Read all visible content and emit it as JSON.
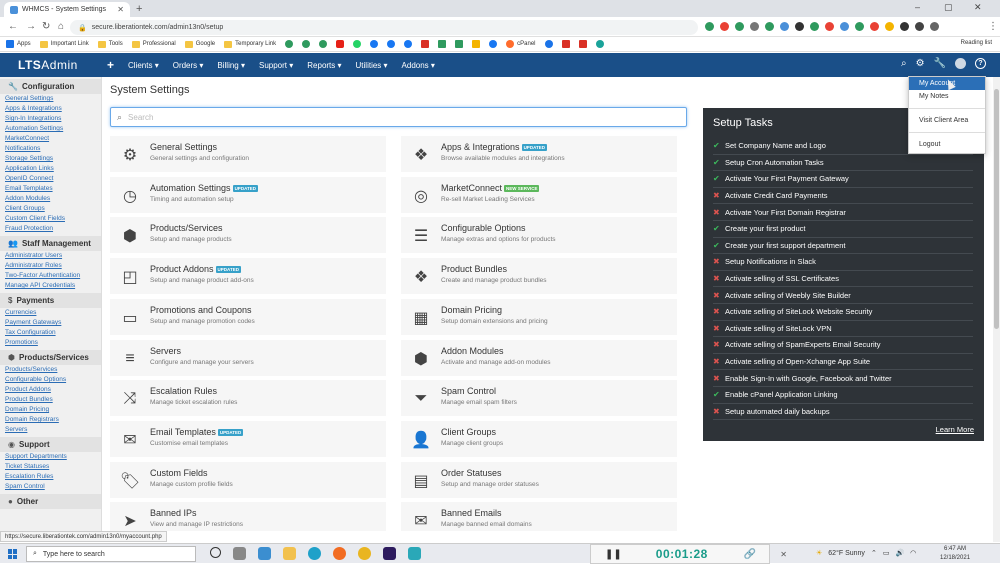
{
  "browser": {
    "tab_title": "WHMCS - System Settings",
    "url": "secure.liberationtek.com/admin13n0/setup",
    "bookmarks": [
      "Apps",
      "Important Link",
      "Tools",
      "Professional",
      "Google",
      "Temporary Link",
      "cPanel"
    ],
    "reading_list": "Reading list"
  },
  "nav": {
    "logo_bold": "LTS",
    "logo_thin": "Admin",
    "plus": "+",
    "menus": [
      "Clients ▾",
      "Orders ▾",
      "Billing ▾",
      "Support ▾",
      "Reports ▾",
      "Utilities ▾",
      "Addons ▾"
    ]
  },
  "dropdown": {
    "items": [
      "My Account",
      "My Notes",
      "Visit Client Area",
      "Logout"
    ]
  },
  "sidebar": {
    "sections": [
      {
        "title": "Configuration",
        "links": [
          "General Settings",
          "Apps & Integrations",
          "Sign-In Integrations",
          "Automation Settings",
          "MarketConnect",
          "Notifications",
          "Storage Settings",
          "Application Links",
          "OpenID Connect",
          "Email Templates",
          "Addon Modules",
          "Client Groups",
          "Custom Client Fields",
          "Fraud Protection"
        ]
      },
      {
        "title": "Staff Management",
        "links": [
          "Administrator Users",
          "Administrator Roles",
          "Two-Factor Authentication",
          "Manage API Credentials"
        ]
      },
      {
        "title": "Payments",
        "links": [
          "Currencies",
          "Payment Gateways",
          "Tax Configuration",
          "Promotions"
        ]
      },
      {
        "title": "Products/Services",
        "links": [
          "Products/Services",
          "Configurable Options",
          "Product Addons",
          "Product Bundles",
          "Domain Pricing",
          "Domain Registrars",
          "Servers"
        ]
      },
      {
        "title": "Support",
        "links": [
          "Support Departments",
          "Ticket Statuses",
          "Escalation Rules",
          "Spam Control"
        ]
      },
      {
        "title": "Other",
        "links": []
      }
    ]
  },
  "main": {
    "title": "System Settings",
    "search_placeholder": "Search",
    "cards": [
      {
        "title": "General Settings",
        "desc": "General settings and configuration",
        "badge": "",
        "icon": "gear-icon",
        "glyph": "⚙"
      },
      {
        "title": "Apps & Integrations",
        "desc": "Browse available modules and integrations",
        "badge": "UPDATED",
        "icon": "puzzle-icon",
        "glyph": "❖"
      },
      {
        "title": "Automation Settings",
        "desc": "Timing and automation setup",
        "badge": "UPDATED",
        "icon": "clock-icon",
        "glyph": "◷"
      },
      {
        "title": "MarketConnect",
        "desc": "Re-sell Market Leading Services",
        "badge": "NEW SERVICE",
        "icon": "target-icon",
        "glyph": "◎"
      },
      {
        "title": "Products/Services",
        "desc": "Setup and manage products",
        "badge": "",
        "icon": "cube-icon",
        "glyph": "⬢"
      },
      {
        "title": "Configurable Options",
        "desc": "Manage extras and options for products",
        "badge": "",
        "icon": "sliders-icon",
        "glyph": "☰"
      },
      {
        "title": "Product Addons",
        "desc": "Setup and manage product add-ons",
        "badge": "UPDATED",
        "icon": "addon-icon",
        "glyph": "◰"
      },
      {
        "title": "Product Bundles",
        "desc": "Create and manage product bundles",
        "badge": "",
        "icon": "cubes-icon",
        "glyph": "❖"
      },
      {
        "title": "Promotions and Coupons",
        "desc": "Setup and manage promotion codes",
        "badge": "",
        "icon": "ticket-icon",
        "glyph": "▭"
      },
      {
        "title": "Domain Pricing",
        "desc": "Setup domain extensions and pricing",
        "badge": "",
        "icon": "grid-icon",
        "glyph": "▦"
      },
      {
        "title": "Servers",
        "desc": "Configure and manage your servers",
        "badge": "",
        "icon": "server-icon",
        "glyph": "≡"
      },
      {
        "title": "Addon Modules",
        "desc": "Activate and manage add-on modules",
        "badge": "",
        "icon": "module-icon",
        "glyph": "⬢"
      },
      {
        "title": "Escalation Rules",
        "desc": "Manage ticket escalation rules",
        "badge": "",
        "icon": "random-icon",
        "glyph": "⤨"
      },
      {
        "title": "Spam Control",
        "desc": "Manage email spam filters",
        "badge": "",
        "icon": "filter-icon",
        "glyph": "⏷"
      },
      {
        "title": "Email Templates",
        "desc": "Customise email templates",
        "badge": "UPDATED",
        "icon": "envelope-icon",
        "glyph": "✉"
      },
      {
        "title": "Client Groups",
        "desc": "Manage client groups",
        "badge": "",
        "icon": "user-icon",
        "glyph": "👤"
      },
      {
        "title": "Custom Fields",
        "desc": "Manage custom profile fields",
        "badge": "",
        "icon": "tags-icon",
        "glyph": "🏷"
      },
      {
        "title": "Order Statuses",
        "desc": "Setup and manage order statuses",
        "badge": "",
        "icon": "file-icon",
        "glyph": "▤"
      },
      {
        "title": "Banned IPs",
        "desc": "View and manage IP restrictions",
        "badge": "",
        "icon": "plane-icon",
        "glyph": "➤"
      },
      {
        "title": "Banned Emails",
        "desc": "Manage banned email domains",
        "badge": "",
        "icon": "envelope-icon",
        "glyph": "✉"
      }
    ]
  },
  "setup": {
    "title": "Setup Tasks",
    "learn_more": "Learn More",
    "tasks": [
      {
        "label": "Set Company Name and Logo",
        "done": true
      },
      {
        "label": "Setup Cron Automation Tasks",
        "done": true
      },
      {
        "label": "Activate Your First Payment Gateway",
        "done": true
      },
      {
        "label": "Activate Credit Card Payments",
        "done": false
      },
      {
        "label": "Activate Your First Domain Registrar",
        "done": false
      },
      {
        "label": "Create your first product",
        "done": true
      },
      {
        "label": "Create your first support department",
        "done": true
      },
      {
        "label": "Setup Notifications in Slack",
        "done": false
      },
      {
        "label": "Activate selling of SSL Certificates",
        "done": false
      },
      {
        "label": "Activate selling of Weebly Site Builder",
        "done": false
      },
      {
        "label": "Activate selling of SiteLock Website Security",
        "done": false
      },
      {
        "label": "Activate selling of SiteLock VPN",
        "done": false
      },
      {
        "label": "Activate selling of SpamExperts Email Security",
        "done": false
      },
      {
        "label": "Activate selling of Open-Xchange App Suite",
        "done": false
      },
      {
        "label": "Enable Sign-In with Google, Facebook and Twitter",
        "done": false
      },
      {
        "label": "Enable cPanel Application Linking",
        "done": true
      },
      {
        "label": "Setup automated daily backups",
        "done": false
      }
    ]
  },
  "status_url": "https://secure.liberationtek.com/admin13n0/myaccount.php",
  "taskbar": {
    "search_placeholder": "Type here to search",
    "timer": "00:01:28",
    "weather": "62°F Sunny",
    "time": "6:47 AM",
    "date": "12/18/2021"
  }
}
